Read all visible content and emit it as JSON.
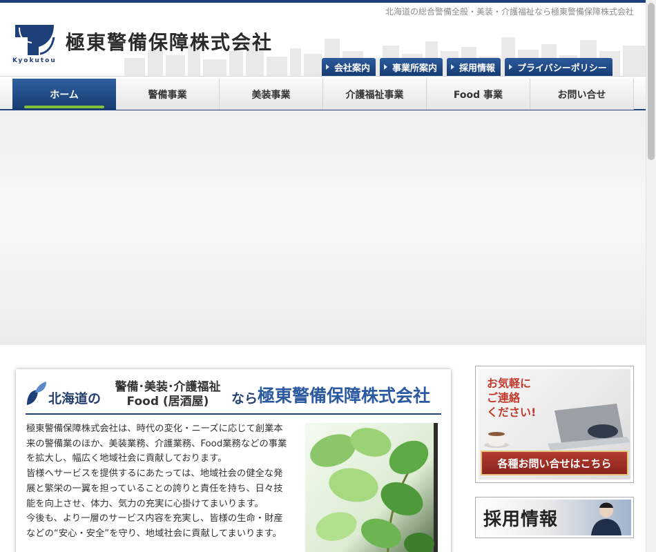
{
  "header": {
    "tagline": "北海道の総合警備全般・美装・介護福祉なら極東警備保障株式会社",
    "brand_name": "極東警備保障株式会社",
    "logo_text": "Kyokutou"
  },
  "top_links": [
    {
      "label": "会社案内"
    },
    {
      "label": "事業所案内"
    },
    {
      "label": "採用情報"
    },
    {
      "label": "プライバシーポリシー"
    }
  ],
  "nav": [
    {
      "label": "ホーム",
      "active": true
    },
    {
      "label": "警備事業"
    },
    {
      "label": "美装事業"
    },
    {
      "label": "介護福祉事業"
    },
    {
      "label": "Food 事業"
    },
    {
      "label": "お問い合せ"
    }
  ],
  "intro": {
    "headline_prefix": "北海道の",
    "headline_services_1": "警備･美装･介護福祉",
    "headline_services_2": "Food (居酒屋)",
    "headline_connector": "なら",
    "headline_company": "極東警備保障株式会社",
    "paragraphs": [
      "極東警備保障株式会社は、時代の変化・ニーズに応じて創業本来の警備業のほか、美装業務、介護業務、Food業務などの事業を拡大し、幅広く地域社会に貢献しております。",
      "皆様へサービスを提供するにあたっては、地域社会の健全な発展と繁栄の一翼を担っていることの誇りと責任を持ち、日々技能を向上させ、体力、気力の充実に心掛けてまいります。",
      "今後も、より一層のサービス内容を充実し、皆様の生命・財産などの“安心・安全”を守り、地域社会に貢献してまいります。"
    ]
  },
  "sidebar": {
    "contact_banner_text": "お気軽に ご連絡 ください!",
    "contact_banner_line1": "お気軽に",
    "contact_banner_line2": "ご連絡",
    "contact_banner_line3": "ください!",
    "contact_button": "各種お問い合せはこちら",
    "recruit_banner": "採用情報"
  },
  "colors": {
    "brand_navy": "#1d3f7a",
    "nav_active_underline": "#7fc33a",
    "contact_button": "#a3322a"
  }
}
